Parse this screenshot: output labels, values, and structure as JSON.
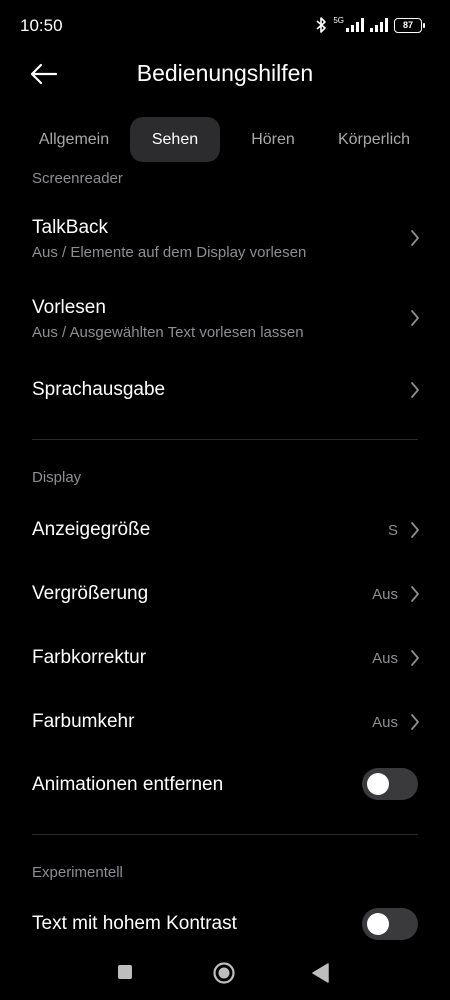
{
  "status_bar": {
    "time": "10:50",
    "network_label": "5G",
    "battery_level": "87",
    "icons": [
      "bluetooth-icon",
      "signal-icon",
      "signal-icon",
      "battery-icon"
    ]
  },
  "header": {
    "title": "Bedienungshilfen",
    "back_icon": "arrow-left-icon"
  },
  "tabs": [
    {
      "label": "Allgemein",
      "active": false
    },
    {
      "label": "Sehen",
      "active": true
    },
    {
      "label": "Hören",
      "active": false
    },
    {
      "label": "Körperlich",
      "active": false
    }
  ],
  "sections": {
    "screenreader": {
      "label": "Screenreader",
      "items": [
        {
          "title": "TalkBack",
          "subtitle": "Aus / Elemente auf dem Display vorlesen"
        },
        {
          "title": "Vorlesen",
          "subtitle": "Aus / Ausgewählten Text vorlesen lassen"
        },
        {
          "title": "Sprachausgabe"
        }
      ]
    },
    "display": {
      "label": "Display",
      "items": [
        {
          "title": "Anzeigegröße",
          "value": "S"
        },
        {
          "title": "Vergrößerung",
          "value": "Aus"
        },
        {
          "title": "Farbkorrektur",
          "value": "Aus"
        },
        {
          "title": "Farbumkehr",
          "value": "Aus"
        },
        {
          "title": "Animationen entfernen",
          "toggle": false
        }
      ]
    },
    "experimental": {
      "label": "Experimentell",
      "items": [
        {
          "title": "Text mit hohem Kontrast",
          "toggle": false
        }
      ]
    }
  },
  "colors": {
    "background": "#000000",
    "active_tab": "#2c2c2e",
    "secondary_text": "#8e8e93",
    "toggle_off": "#3a3a3c"
  },
  "nav_bar": {
    "icons": [
      "square-recent-icon",
      "circle-home-icon",
      "triangle-back-icon"
    ]
  }
}
